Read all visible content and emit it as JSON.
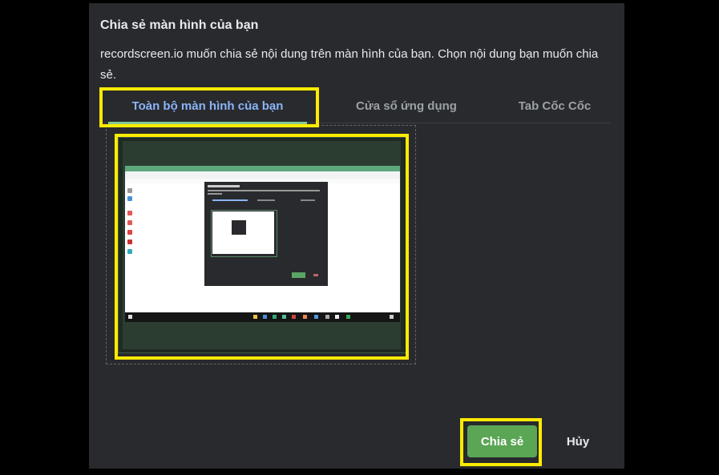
{
  "dialog": {
    "title": "Chia sẻ màn hình của bạn",
    "description": "recordscreen.io muốn chia sẻ nội dung trên màn hình của bạn. Chọn nội dung bạn muốn chia sẻ."
  },
  "tabs": [
    {
      "label": "Toàn bộ màn hình của bạn",
      "active": true
    },
    {
      "label": "Cửa sổ ứng dụng",
      "active": false
    },
    {
      "label": "Tab Cốc Cốc",
      "active": false
    }
  ],
  "source": {
    "thumbnail_icon": "screen-thumbnail"
  },
  "buttons": {
    "share": "Chia sẻ",
    "cancel": "Hủy"
  },
  "colors": {
    "highlight": "#ffeb00",
    "accent_tab": "#8ab4f8",
    "tab_underline": "#81c995",
    "share_button": "#5aa654",
    "dialog_bg": "#292a2d"
  }
}
